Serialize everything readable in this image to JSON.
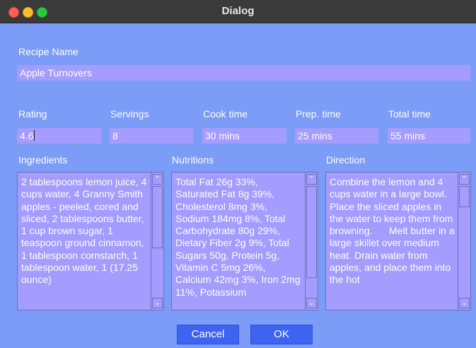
{
  "window": {
    "title": "Dialog"
  },
  "recipe": {
    "label": "Recipe Name",
    "value": "Apple Turnovers"
  },
  "fields": {
    "rating": {
      "label": "Rating",
      "value": "4.6"
    },
    "servings": {
      "label": "Servings",
      "value": "8"
    },
    "cook_time": {
      "label": "Cook time",
      "value": "30 mins"
    },
    "prep_time": {
      "label": "Prep. time",
      "value": "25 mins"
    },
    "total_time": {
      "label": "Total time",
      "value": "55 mins"
    }
  },
  "sections": {
    "ingredients": {
      "label": "Ingredients",
      "text": "2 tablespoons lemon juice, 4 cups water, 4 Granny Smith apples - peeled, cored and sliced, 2 tablespoons butter, 1 cup brown sugar, 1 teaspoon ground cinnamon, 1 tablespoon cornstarch, 1 tablespoon water, 1 (17.25 ounce)"
    },
    "nutritions": {
      "label": "Nutritions",
      "text": "Total Fat 26g 33%, Saturated Fat 8g 39%, Cholesterol 8mg 3%, Sodium 184mg 8%, Total Carbohydrate 80g 29%, Dietary Fiber 2g 9%, Total Sugars 50g, Protein 5g, Vitamin C 5mg 26%, Calcium 42mg 3%, Iron 2mg 11%, Potassium"
    },
    "direction": {
      "label": "Direction",
      "text": "Combine the lemon and 4 cups water in a large bowl. Place the sliced apples in the water to keep them from browning.      Melt butter in a large skillet over medium heat. Drain water from apples, and place them into the hot"
    }
  },
  "buttons": {
    "cancel": "Cancel",
    "ok": "OK"
  },
  "icons": {
    "scroll_up": "chevron-up-icon",
    "scroll_down": "chevron-down-icon"
  },
  "colors": {
    "background": "#7b9cf7",
    "field": "#a49cff",
    "button": "#3d63f0"
  }
}
